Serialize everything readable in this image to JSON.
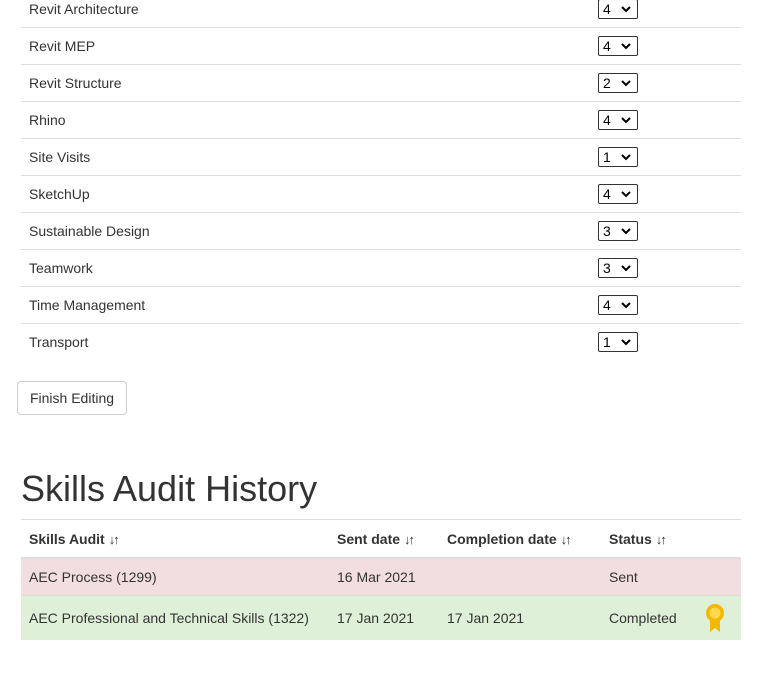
{
  "skills": [
    {
      "label": "Revit Architecture",
      "rating": "4"
    },
    {
      "label": "Revit MEP",
      "rating": "4"
    },
    {
      "label": "Revit Structure",
      "rating": "2"
    },
    {
      "label": "Rhino",
      "rating": "4"
    },
    {
      "label": "Site Visits",
      "rating": "1"
    },
    {
      "label": "SketchUp",
      "rating": "4"
    },
    {
      "label": "Sustainable Design",
      "rating": "3"
    },
    {
      "label": "Teamwork",
      "rating": "3"
    },
    {
      "label": "Time Management",
      "rating": "4"
    },
    {
      "label": "Transport",
      "rating": "1"
    }
  ],
  "finish_button": "Finish Editing",
  "history": {
    "title": "Skills Audit History",
    "columns": [
      "Skills Audit",
      "Sent date",
      "Completion date",
      "Status"
    ],
    "sort_icon": "↓↑",
    "rows": [
      {
        "audit": "AEC Process (1299)",
        "sent": "16 Mar 2021",
        "completed": "",
        "status": "Sent"
      },
      {
        "audit": "AEC Professional and Technical Skills (1322)",
        "sent": "17 Jan 2021",
        "completed": "17 Jan 2021",
        "status": "Completed",
        "icon": "award-icon"
      }
    ]
  },
  "colors": {
    "sent_row": "#f2dede",
    "completed_row": "#dff0d8",
    "award": "#f5b800"
  }
}
